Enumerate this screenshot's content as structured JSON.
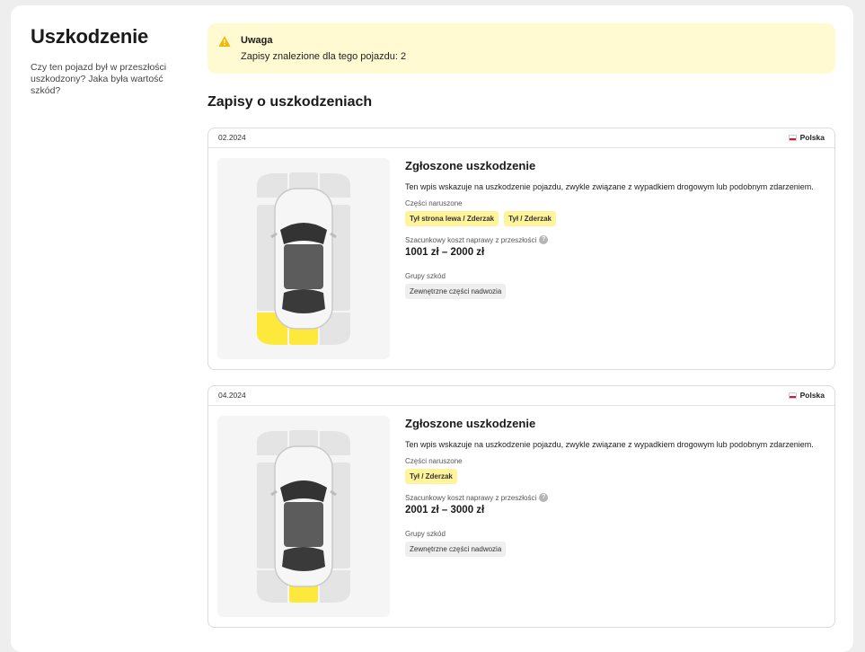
{
  "sidebar": {
    "title": "Uszkodzenie",
    "description": "Czy ten pojazd był w przeszłości uszkodzony? Jaka była wartość szkód?"
  },
  "alert": {
    "title": "Uwaga",
    "text": "Zapisy znalezione dla tego pojazdu: 2",
    "icon": "warning-icon",
    "color": "#f5b800"
  },
  "section_title": "Zapisy o uszkodzeniach",
  "labels": {
    "parts": "Części naruszone",
    "cost": "Szacunkowy koszt naprawy z przeszłości",
    "groups": "Grupy szkód",
    "help": "?"
  },
  "colors": {
    "damage": "#fde93b",
    "panel": "#e4e4e4"
  },
  "records": [
    {
      "date": "02.2024",
      "country": "Polska",
      "title": "Zgłoszone uszkodzenie",
      "description": "Ten wpis wskazuje na uszkodzenie pojazdu, zwykle związane z wypadkiem drogowym lub podobnym zdarzeniem.",
      "parts": [
        "Tył strona lewa / Zderzak",
        "Tył / Zderzak"
      ],
      "cost": "1001 zł – 2000 zł",
      "groups": [
        "Zewnętrzne części nadwozia"
      ],
      "damaged_zones": [
        "rear-left",
        "rear-center"
      ]
    },
    {
      "date": "04.2024",
      "country": "Polska",
      "title": "Zgłoszone uszkodzenie",
      "description": "Ten wpis wskazuje na uszkodzenie pojazdu, zwykle związane z wypadkiem drogowym lub podobnym zdarzeniem.",
      "parts": [
        "Tył / Zderzak"
      ],
      "cost": "2001 zł – 3000 zł",
      "groups": [
        "Zewnętrzne części nadwozia"
      ],
      "damaged_zones": [
        "rear-center"
      ]
    }
  ]
}
